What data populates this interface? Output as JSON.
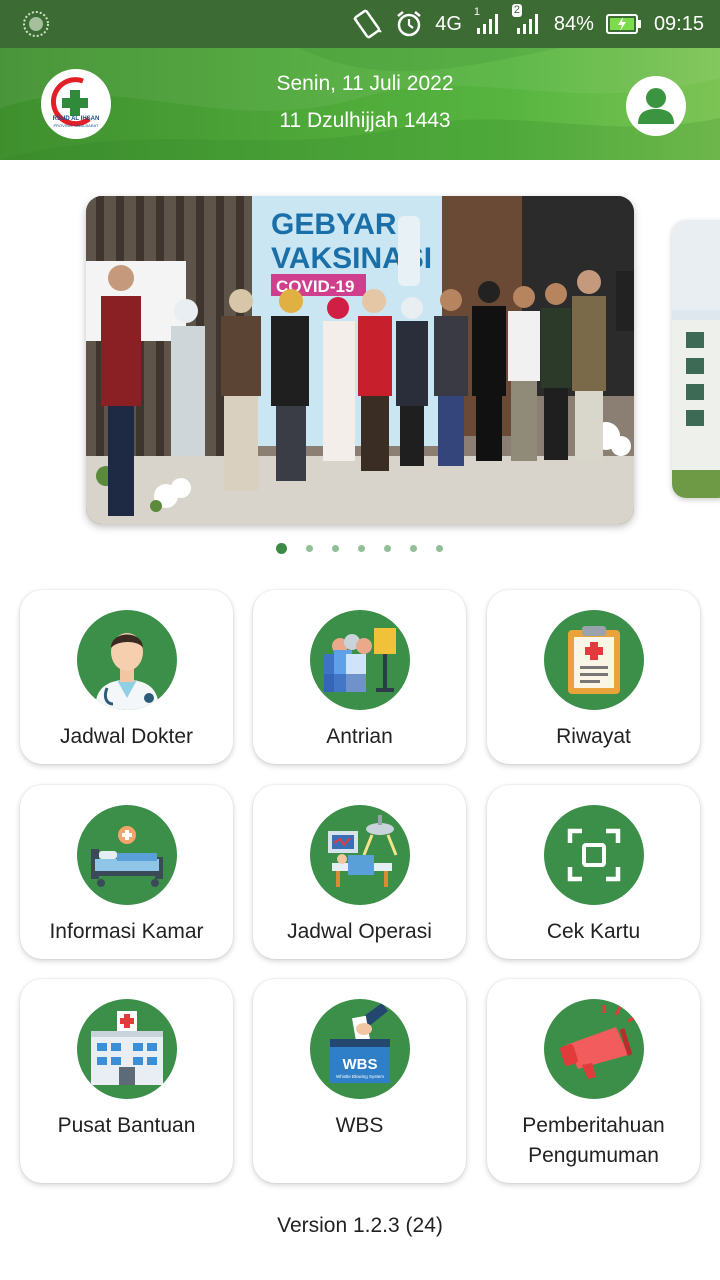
{
  "status_bar": {
    "network": "4G",
    "sim1_badge": "1",
    "sim2_badge": "2",
    "battery": "84%",
    "time": "09:15",
    "icons": [
      "loading-icon",
      "vibrate-icon",
      "alarm-icon",
      "signal-icon",
      "battery-charging-icon"
    ]
  },
  "header": {
    "logo_text": "RSUD AL IHSAN",
    "logo_subtext": "PROVINSI JAWA BARAT",
    "date_gregorian": "Senin, 11 Juli 2022",
    "date_hijri": "11 Dzulhijjah 1443",
    "colors": {
      "primary": "#4fa93a",
      "dark": "#3c6b33",
      "accent": "#3b8f48"
    }
  },
  "carousel": {
    "slide_title_line1": "GEBYAR",
    "slide_title_line2": "VAKSINASI",
    "slide_title_line3": "COVID-19",
    "slide_count": 7,
    "active_index": 0
  },
  "menu": {
    "items": [
      {
        "label": "Jadwal Dokter",
        "icon": "doctor-icon"
      },
      {
        "label": "Antrian",
        "icon": "queue-icon"
      },
      {
        "label": "Riwayat",
        "icon": "clipboard-icon"
      },
      {
        "label": "Informasi Kamar",
        "icon": "hospital-bed-icon"
      },
      {
        "label": "Jadwal Operasi",
        "icon": "operation-icon"
      },
      {
        "label": "Cek Kartu",
        "icon": "scan-card-icon"
      },
      {
        "label": "Pusat Bantuan",
        "icon": "hospital-building-icon"
      },
      {
        "label": "WBS",
        "icon": "ballot-box-icon",
        "box_text": "WBS",
        "box_subtext": "Whistle Blowing System"
      },
      {
        "label_line1": "Pemberitahuan",
        "label_line2": "Pengumuman",
        "icon": "megaphone-icon"
      }
    ]
  },
  "footer": {
    "version": "Version 1.2.3 (24)"
  }
}
